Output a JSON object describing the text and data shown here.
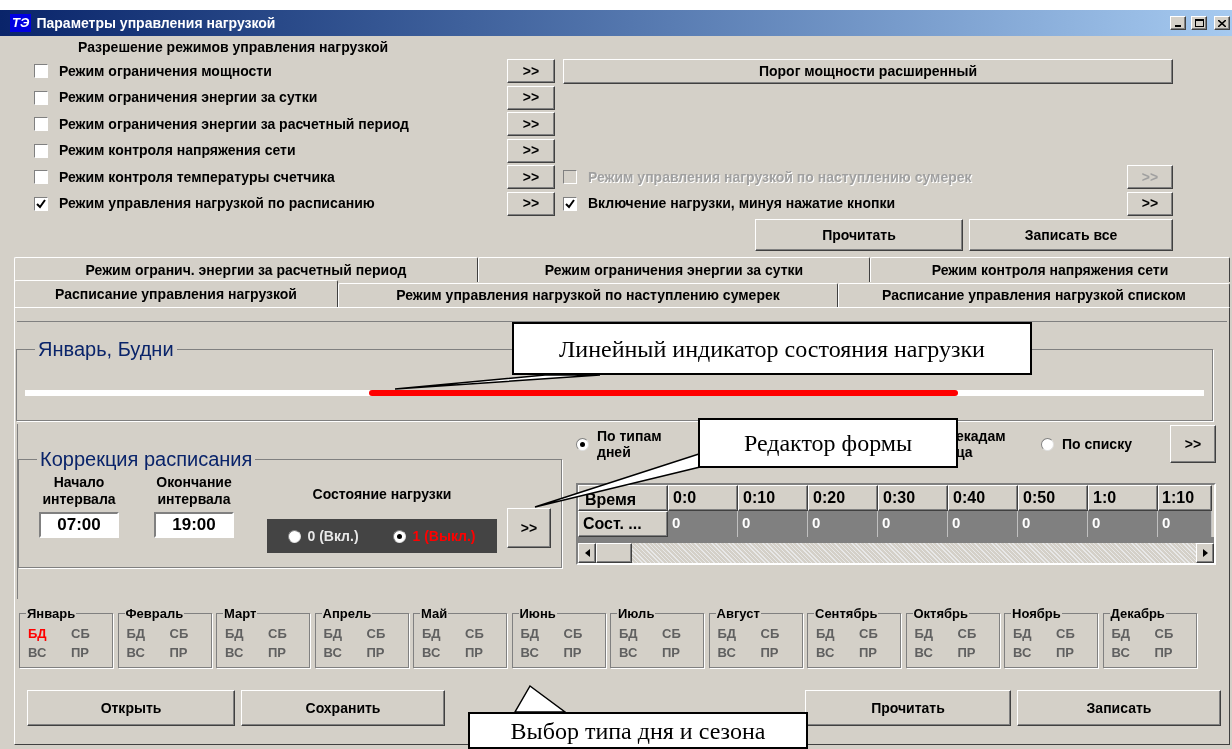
{
  "window": {
    "logo": "ТЭ",
    "title": "Параметры управления нагрузкой"
  },
  "modes": {
    "heading": "Разрешение режимов управления нагрузкой",
    "items": [
      {
        "label": "Режим ограничения мощности",
        "checked": false,
        "button": ">>"
      },
      {
        "label": "Режим ограничения энергии за сутки",
        "checked": false,
        "button": ">>"
      },
      {
        "label": "Режим ограничения энергии за расчетный период",
        "checked": false,
        "button": ">>"
      },
      {
        "label": "Режим контроля напряжения сети",
        "checked": false,
        "button": ">>"
      },
      {
        "label": "Режим контроля температуры счетчика",
        "checked": false,
        "button": ">>"
      },
      {
        "label": "Режим управления нагрузкой по расписанию",
        "checked": true,
        "button": ">>"
      }
    ]
  },
  "extended_button": "Порог мощности расширенный",
  "extra_modes": [
    {
      "label": "Режим управления нагрузкой по наступлению сумерек",
      "checked": false,
      "disabled": true,
      "button": ">>"
    },
    {
      "label": "Включение нагрузки, минуя нажатие кнопки",
      "checked": true,
      "disabled": false,
      "button": ">>"
    }
  ],
  "top_buttons": [
    "Прочитать",
    "Записать все"
  ],
  "tabs": {
    "back_row": [
      {
        "label": "Режим огранич. энергии за расчетный период",
        "selected": false
      },
      {
        "label": "Режим ограничения энергии за сутки",
        "selected": false
      },
      {
        "label": "Режим контроля напряжения сети",
        "selected": false
      }
    ],
    "front_row": [
      {
        "label": "Расписание управления нагрузкой",
        "selected": true
      },
      {
        "label": "Режим управления нагрузкой по наступлению сумерек",
        "selected": false
      },
      {
        "label": "Расписание управления нагрузкой списком",
        "selected": false
      }
    ]
  },
  "schedule_panel": {
    "title": "Январь, Будни"
  },
  "correction": {
    "title": "Коррекция расписания",
    "start": {
      "label_lines": [
        "Начало",
        "интервала"
      ],
      "value": "07:00"
    },
    "end": {
      "label_lines": [
        "Окончание",
        "интервала"
      ],
      "value": "19:00"
    },
    "state_label": "Состояние нагрузки",
    "states": [
      {
        "label": "0 (Вкл.)",
        "selected": false
      },
      {
        "label": "1 (Выкл.)",
        "selected": true
      }
    ],
    "apply_button": ">>"
  },
  "view": {
    "options": [
      {
        "kind": "radio",
        "label_lines": [
          "По типам",
          "дней"
        ],
        "selected": true
      },
      {
        "kind": "covered",
        "label_lines": [
          "екадам",
          "ца"
        ]
      },
      {
        "kind": "radio",
        "label_lines": [
          "По списку"
        ],
        "selected": false
      }
    ],
    "button": ">>"
  },
  "grid": {
    "columns": [
      "Время",
      "0:0",
      "0:10",
      "0:20",
      "0:30",
      "0:40",
      "0:50",
      "1:0",
      "1:10"
    ],
    "rows": [
      [
        "Сост. ...",
        "0",
        "0",
        "0",
        "0",
        "0",
        "0",
        "0",
        "0"
      ]
    ]
  },
  "months": [
    {
      "name": "Январь",
      "day_types": [
        {
          "label": "БД",
          "selected": true
        },
        {
          "label": "СБ",
          "selected": false
        },
        {
          "label": "ВС",
          "selected": false
        },
        {
          "label": "ПР",
          "selected": false
        }
      ]
    },
    {
      "name": "Февраль",
      "day_types": [
        {
          "label": "БД",
          "selected": false
        },
        {
          "label": "СБ",
          "selected": false
        },
        {
          "label": "ВС",
          "selected": false
        },
        {
          "label": "ПР",
          "selected": false
        }
      ]
    },
    {
      "name": "Март",
      "day_types": [
        {
          "label": "БД",
          "selected": false
        },
        {
          "label": "СБ",
          "selected": false
        },
        {
          "label": "ВС",
          "selected": false
        },
        {
          "label": "ПР",
          "selected": false
        }
      ]
    },
    {
      "name": "Апрель",
      "day_types": [
        {
          "label": "БД",
          "selected": false
        },
        {
          "label": "СБ",
          "selected": false
        },
        {
          "label": "ВС",
          "selected": false
        },
        {
          "label": "ПР",
          "selected": false
        }
      ]
    },
    {
      "name": "Май",
      "day_types": [
        {
          "label": "БД",
          "selected": false
        },
        {
          "label": "СБ",
          "selected": false
        },
        {
          "label": "ВС",
          "selected": false
        },
        {
          "label": "ПР",
          "selected": false
        }
      ]
    },
    {
      "name": "Июнь",
      "day_types": [
        {
          "label": "БД",
          "selected": false
        },
        {
          "label": "СБ",
          "selected": false
        },
        {
          "label": "ВС",
          "selected": false
        },
        {
          "label": "ПР",
          "selected": false
        }
      ]
    },
    {
      "name": "Июль",
      "day_types": [
        {
          "label": "БД",
          "selected": false
        },
        {
          "label": "СБ",
          "selected": false
        },
        {
          "label": "ВС",
          "selected": false
        },
        {
          "label": "ПР",
          "selected": false
        }
      ]
    },
    {
      "name": "Август",
      "day_types": [
        {
          "label": "БД",
          "selected": false
        },
        {
          "label": "СБ",
          "selected": false
        },
        {
          "label": "ВС",
          "selected": false
        },
        {
          "label": "ПР",
          "selected": false
        }
      ]
    },
    {
      "name": "Сентябрь",
      "day_types": [
        {
          "label": "БД",
          "selected": false
        },
        {
          "label": "СБ",
          "selected": false
        },
        {
          "label": "ВС",
          "selected": false
        },
        {
          "label": "ПР",
          "selected": false
        }
      ]
    },
    {
      "name": "Октябрь",
      "day_types": [
        {
          "label": "БД",
          "selected": false
        },
        {
          "label": "СБ",
          "selected": false
        },
        {
          "label": "ВС",
          "selected": false
        },
        {
          "label": "ПР",
          "selected": false
        }
      ]
    },
    {
      "name": "Ноябрь",
      "day_types": [
        {
          "label": "БД",
          "selected": false
        },
        {
          "label": "СБ",
          "selected": false
        },
        {
          "label": "ВС",
          "selected": false
        },
        {
          "label": "ПР",
          "selected": false
        }
      ]
    },
    {
      "name": "Декабрь",
      "day_types": [
        {
          "label": "БД",
          "selected": false
        },
        {
          "label": "СБ",
          "selected": false
        },
        {
          "label": "ВС",
          "selected": false
        },
        {
          "label": "ПР",
          "selected": false
        }
      ]
    }
  ],
  "bottom_buttons_left": [
    "Открыть",
    "Сохранить"
  ],
  "bottom_buttons_right": [
    "Прочитать",
    "Записать"
  ],
  "callouts": [
    "Линейный индикатор состояния нагрузки",
    "Редактор формы",
    "Выбор типа дня и сезона"
  ]
}
